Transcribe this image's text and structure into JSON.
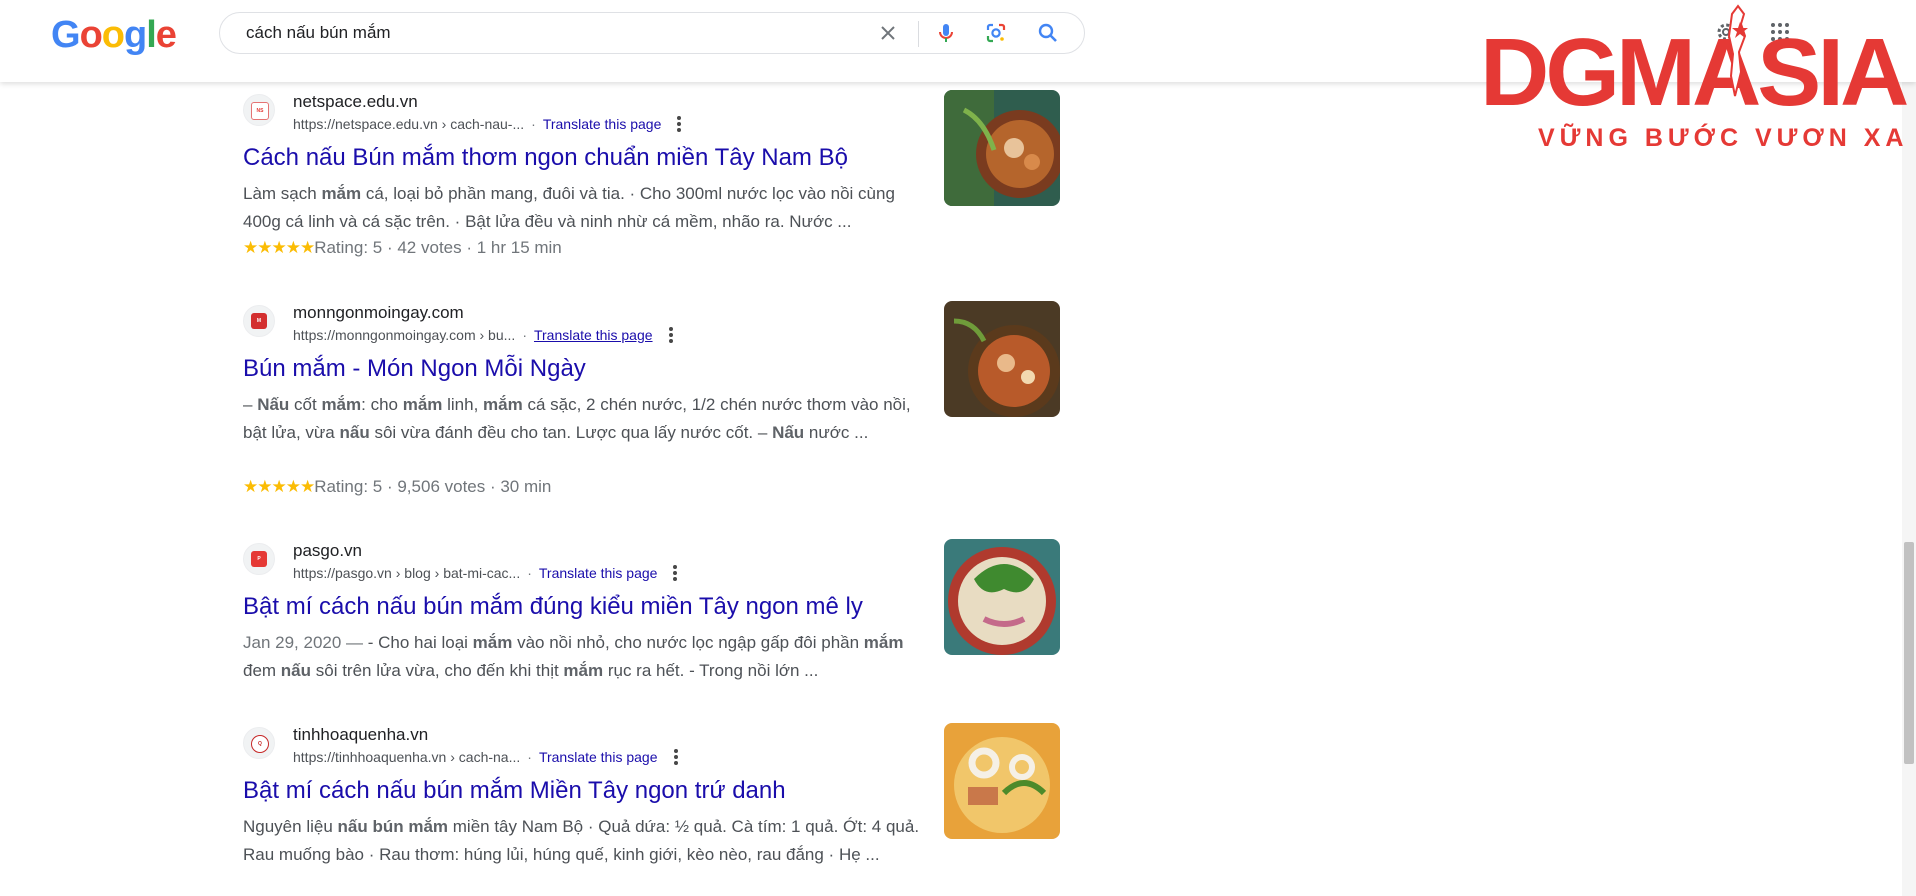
{
  "header": {
    "logo_letters": [
      "G",
      "o",
      "o",
      "g",
      "l",
      "e"
    ],
    "logo_colors": [
      "#4285F4",
      "#EA4335",
      "#FBBC05",
      "#4285F4",
      "#34A853",
      "#EA4335"
    ],
    "query": "cách nấu bún mắm",
    "icons": [
      "clear-icon",
      "microphone-icon",
      "lens-icon",
      "search-icon",
      "settings-icon",
      "apps-icon"
    ]
  },
  "watermark": {
    "brand": "DGMASIA",
    "tagline": "VỮNG BƯỚC VƯƠN XA",
    "color": "#E53935"
  },
  "results": [
    {
      "site": "netspace.edu.vn",
      "url": "https://netspace.edu.vn › cach-nau-...",
      "translate": "Translate this page",
      "title": "Cách nấu Bún mắm thơm ngon chuẩn miền Tây Nam Bộ",
      "snippet_parts": [
        {
          "t": "Làm sạch ",
          "b": false
        },
        {
          "t": "mắm",
          "b": true
        },
        {
          "t": " cá, loại bỏ phần mang, đuôi và tia. · Cho 300ml nước lọc vào nồi cùng 400g cá linh và cá sặc trên. · Bật lửa đều và ninh nhừ cá mềm, nhão ra. Nước ...",
          "b": false
        }
      ],
      "stars": "★★★★★",
      "rating": "Rating: 5 · 42 votes · 1 hr 15 min",
      "favicon_color": "#ffffff"
    },
    {
      "site": "monngonmoingay.com",
      "url": "https://monngonmoingay.com › bu...",
      "translate": "Translate this page",
      "title": "Bún mắm - Món Ngon Mỗi Ngày",
      "snippet_parts": [
        {
          "t": "– ",
          "b": false
        },
        {
          "t": "Nấu",
          "b": true
        },
        {
          "t": " cốt ",
          "b": false
        },
        {
          "t": "mắm",
          "b": true
        },
        {
          "t": ": cho ",
          "b": false
        },
        {
          "t": "mắm",
          "b": true
        },
        {
          "t": " linh, ",
          "b": false
        },
        {
          "t": "mắm",
          "b": true
        },
        {
          "t": " cá sặc, 2 chén nước, 1/2 chén nước thơm vào nồi, bật lửa, vừa ",
          "b": false
        },
        {
          "t": "nấu",
          "b": true
        },
        {
          "t": " sôi vừa đánh đều cho tan. Lược qua lấy nước cốt. – ",
          "b": false
        },
        {
          "t": "Nấu",
          "b": true
        },
        {
          "t": " nước ...",
          "b": false
        }
      ],
      "stars": "★★★★★",
      "rating": "Rating: 5 · 9,506 votes · 30 min",
      "favicon_color": "#d32f2f"
    },
    {
      "site": "pasgo.vn",
      "url": "https://pasgo.vn › blog › bat-mi-cac...",
      "translate": "Translate this page",
      "title": "Bật mí cách nấu bún mắm đúng kiểu miền Tây ngon mê ly",
      "snippet_parts": [
        {
          "t": "Jan 29, 2020 — ",
          "b": false
        },
        {
          "t": "- Cho hai loại ",
          "b": false
        },
        {
          "t": "mắm",
          "b": true
        },
        {
          "t": " vào nồi nhỏ, cho nước lọc ngập gấp đôi phần ",
          "b": false
        },
        {
          "t": "mắm",
          "b": true
        },
        {
          "t": " đem ",
          "b": false
        },
        {
          "t": "nấu",
          "b": true
        },
        {
          "t": " sôi trên lửa vừa, cho đến khi thịt ",
          "b": false
        },
        {
          "t": "mắm",
          "b": true
        },
        {
          "t": " rục ra hết. - Trong nồi lớn ...",
          "b": false
        }
      ],
      "favicon_color": "#e53935"
    },
    {
      "site": "tinhhoaquenha.vn",
      "url": "https://tinhhoaquenha.vn › cach-na...",
      "translate": "Translate this page",
      "title": "Bật mí cách nấu bún mắm Miền Tây ngon trứ danh",
      "snippet_parts": [
        {
          "t": "Nguyên liệu ",
          "b": false
        },
        {
          "t": "nấu bún mắm",
          "b": true
        },
        {
          "t": " miền tây Nam Bộ · Quả dứa: ½ quả. Cà tím: 1 quả. Ớt: 4 quả. Rau muống bào · Rau thơm: húng lủi, húng quế, kinh giới, kèo nèo, rau đắng · Hẹ ...",
          "b": false
        }
      ],
      "favicon_color": "#c62828"
    }
  ]
}
